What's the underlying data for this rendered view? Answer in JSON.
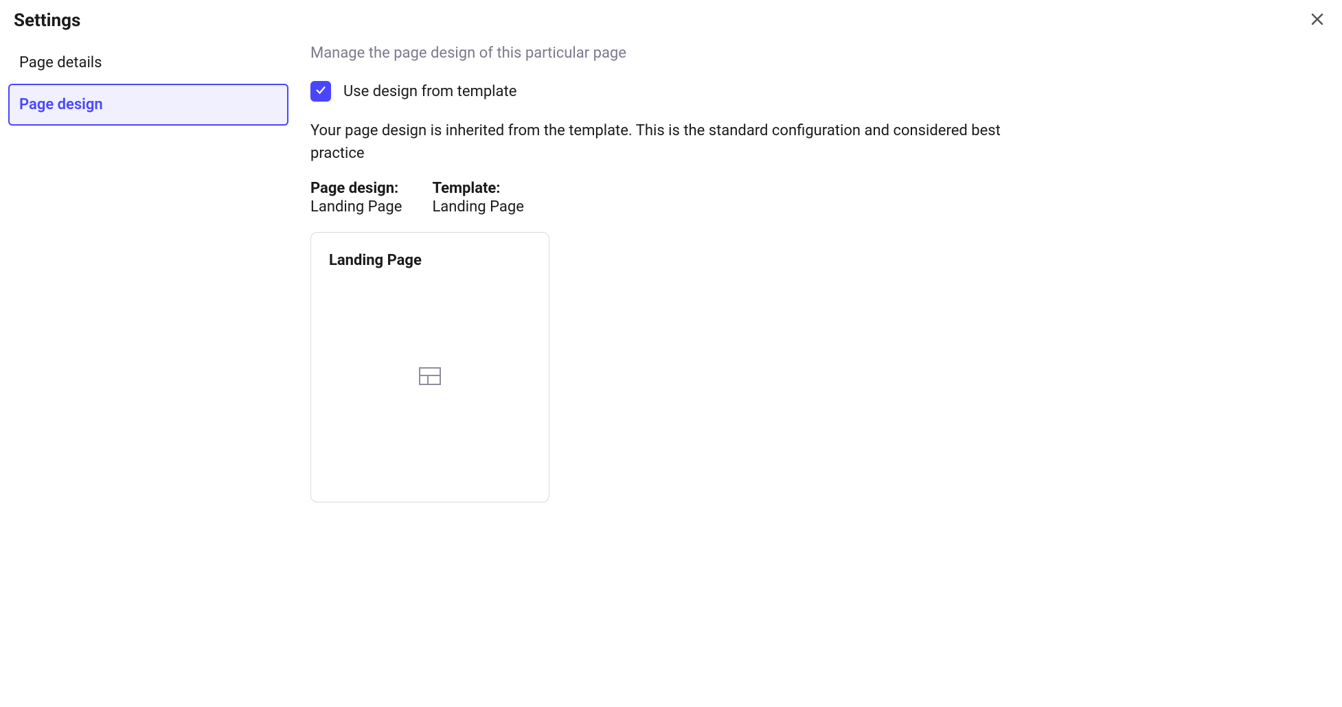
{
  "header": {
    "title": "Settings"
  },
  "sidebar": {
    "items": [
      {
        "label": "Page details",
        "active": false
      },
      {
        "label": "Page design",
        "active": true
      }
    ]
  },
  "main": {
    "subtitle": "Manage the page design of this particular page",
    "checkbox_label": "Use design from template",
    "description": "Your page design is inherited from the template. This is the standard configuration and considered best practice",
    "page_design_label": "Page design:",
    "page_design_value": "Landing Page",
    "template_label": "Template:",
    "template_value": "Landing Page",
    "card": {
      "title": "Landing Page"
    }
  }
}
